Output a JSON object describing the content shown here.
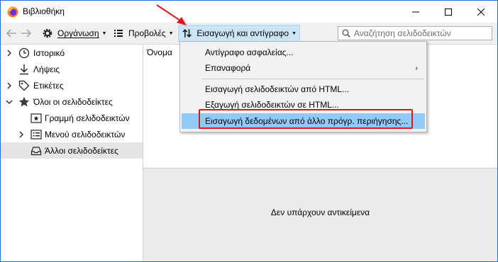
{
  "window": {
    "title": "Βιβλιοθήκη",
    "controls": {
      "minimize": "minimize-icon",
      "maximize": "maximize-icon",
      "close": "close-icon"
    }
  },
  "toolbar": {
    "organize_label": "Οργάνωση",
    "views_label": "Προβολές",
    "import_label": "Εισαγωγή και αντίγραφο",
    "search_placeholder": "Αναζήτηση σελιδοδεικτών"
  },
  "sidebar": {
    "items": [
      {
        "label": "Ιστορικό",
        "icon": "clock-icon",
        "expander": "chevron-right"
      },
      {
        "label": "Λήψεις",
        "icon": "download-icon",
        "expander": "none"
      },
      {
        "label": "Ετικέτες",
        "icon": "tag-icon",
        "expander": "chevron-right"
      },
      {
        "label": "Όλοι οι σελιδοδείκτες",
        "icon": "star-icon",
        "expander": "chevron-down"
      },
      {
        "label": "Γραμμή σελιδοδεικτών",
        "icon": "bookmarks-toolbar-icon",
        "expander": "none"
      },
      {
        "label": "Μενού σελιδοδεικτών",
        "icon": "bookmarks-menu-icon",
        "expander": "chevron-right"
      },
      {
        "label": "Άλλοι σελιδοδείκτες",
        "icon": "other-bookmarks-icon",
        "expander": "none",
        "selected": true
      }
    ]
  },
  "main": {
    "column_name": "Όνομα",
    "empty_message": "Δεν υπάρχουν αντικείμενα"
  },
  "import_menu": {
    "items": [
      {
        "label": "Αντίγραφο ασφαλείας..."
      },
      {
        "label": "Επαναφορά",
        "has_submenu": true
      },
      {
        "label": "Εισαγωγή σελιδοδεικτών από HTML..."
      },
      {
        "label": "Εξαγωγή σελιδοδεικτών σε HTML..."
      },
      {
        "label": "Εισαγωγή δεδομένων από άλλο πρόγρ. περιήγησης...",
        "highlighted": true
      }
    ]
  },
  "colors": {
    "accent_border": "#1e74d6",
    "menu_highlight": "#91c9f7",
    "annotation_red": "#e3141c",
    "import_button_bg": "#cce4f7"
  }
}
